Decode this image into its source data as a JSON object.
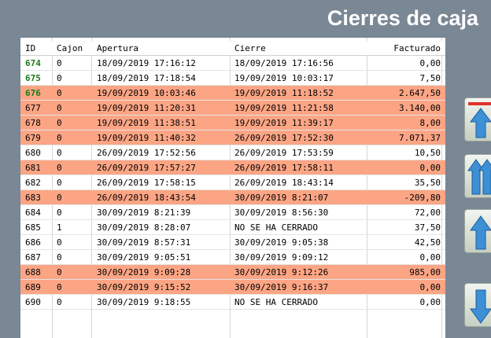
{
  "window": {
    "title": "Cierres de caja"
  },
  "table": {
    "columns": [
      "ID",
      "Cajon",
      "Apertura",
      "Cierre",
      "Facturado"
    ],
    "rows": [
      {
        "id": "674",
        "cajon": "0",
        "apertura": "18/09/2019 17:16:12",
        "cierre": "18/09/2019 17:16:56",
        "facturado": "0,00",
        "highlight": false,
        "id_green": true
      },
      {
        "id": "675",
        "cajon": "0",
        "apertura": "18/09/2019 17:18:54",
        "cierre": "19/09/2019 10:03:17",
        "facturado": "7,50",
        "highlight": false,
        "id_green": true
      },
      {
        "id": "676",
        "cajon": "0",
        "apertura": "19/09/2019 10:03:46",
        "cierre": "19/09/2019 11:18:52",
        "facturado": "2.647,50",
        "highlight": true,
        "id_green": true
      },
      {
        "id": "677",
        "cajon": "0",
        "apertura": "19/09/2019 11:20:31",
        "cierre": "19/09/2019 11:21:58",
        "facturado": "3.140,00",
        "highlight": true,
        "id_green": false
      },
      {
        "id": "678",
        "cajon": "0",
        "apertura": "19/09/2019 11:38:51",
        "cierre": "19/09/2019 11:39:17",
        "facturado": "8,00",
        "highlight": true,
        "id_green": false
      },
      {
        "id": "679",
        "cajon": "0",
        "apertura": "19/09/2019 11:40:32",
        "cierre": "26/09/2019 17:52:30",
        "facturado": "7.071,37",
        "highlight": true,
        "id_green": false
      },
      {
        "id": "680",
        "cajon": "0",
        "apertura": "26/09/2019 17:52:56",
        "cierre": "26/09/2019 17:53:59",
        "facturado": "10,50",
        "highlight": false,
        "id_green": false
      },
      {
        "id": "681",
        "cajon": "0",
        "apertura": "26/09/2019 17:57:27",
        "cierre": "26/09/2019 17:58:11",
        "facturado": "0,00",
        "highlight": true,
        "id_green": false
      },
      {
        "id": "682",
        "cajon": "0",
        "apertura": "26/09/2019 17:58:15",
        "cierre": "26/09/2019 18:43:14",
        "facturado": "35,50",
        "highlight": false,
        "id_green": false
      },
      {
        "id": "683",
        "cajon": "0",
        "apertura": "26/09/2019 18:43:54",
        "cierre": "30/09/2019 8:21:07",
        "facturado": "-209,80",
        "highlight": true,
        "id_green": false
      },
      {
        "id": "684",
        "cajon": "0",
        "apertura": "30/09/2019 8:21:39",
        "cierre": "30/09/2019 8:56:30",
        "facturado": "72,00",
        "highlight": false,
        "id_green": false
      },
      {
        "id": "685",
        "cajon": "1",
        "apertura": "30/09/2019 8:28:07",
        "cierre": "NO SE HA CERRADO",
        "facturado": "37,50",
        "highlight": false,
        "id_green": false
      },
      {
        "id": "686",
        "cajon": "0",
        "apertura": "30/09/2019 8:57:31",
        "cierre": "30/09/2019 9:05:38",
        "facturado": "42,50",
        "highlight": false,
        "id_green": false
      },
      {
        "id": "687",
        "cajon": "0",
        "apertura": "30/09/2019 9:05:51",
        "cierre": "30/09/2019 9:09:12",
        "facturado": "0,00",
        "highlight": false,
        "id_green": false
      },
      {
        "id": "688",
        "cajon": "0",
        "apertura": "30/09/2019 9:09:28",
        "cierre": "30/09/2019 9:12:26",
        "facturado": "985,00",
        "highlight": true,
        "id_green": false
      },
      {
        "id": "689",
        "cajon": "0",
        "apertura": "30/09/2019 9:15:52",
        "cierre": "30/09/2019 9:16:37",
        "facturado": "0,00",
        "highlight": true,
        "id_green": false
      },
      {
        "id": "690",
        "cajon": "0",
        "apertura": "30/09/2019 9:18:55",
        "cierre": "NO SE HA CERRADO",
        "facturado": "0,00",
        "highlight": false,
        "id_green": false
      }
    ]
  },
  "side_buttons": [
    {
      "icon": "scroll-top-icon"
    },
    {
      "icon": "page-up-icon"
    },
    {
      "icon": "row-up-icon"
    },
    {
      "icon": "row-down-icon"
    }
  ],
  "colors": {
    "background": "#7a8794",
    "row_highlight": "#fca585",
    "id_green": "#1a7a1a",
    "arrow_blue": "#3d8fd6",
    "stop_bar_red": "#e0322a"
  }
}
